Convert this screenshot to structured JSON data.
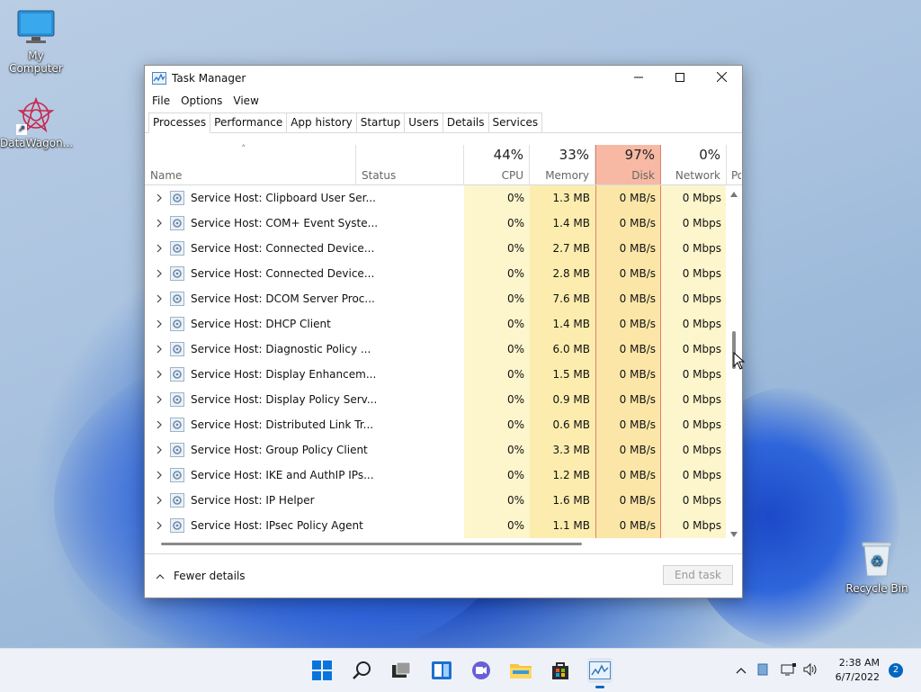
{
  "desktop": {
    "icons": [
      {
        "label": "My Computer",
        "icon": "monitor-icon"
      },
      {
        "label": "DataWagon...",
        "icon": "datawagon-shortcut-icon"
      },
      {
        "label": "Recycle Bin",
        "icon": "recycle-bin-icon"
      }
    ]
  },
  "window": {
    "title": "Task Manager",
    "menu": [
      "File",
      "Options",
      "View"
    ],
    "tabs": [
      "Processes",
      "Performance",
      "App history",
      "Startup",
      "Users",
      "Details",
      "Services"
    ],
    "active_tab": "Processes",
    "columns": {
      "name": "Name",
      "status": "Status",
      "cpu": {
        "pct": "44%",
        "label": "CPU"
      },
      "memory": {
        "pct": "33%",
        "label": "Memory"
      },
      "disk": {
        "pct": "97%",
        "label": "Disk"
      },
      "network": {
        "pct": "0%",
        "label": "Network"
      },
      "power_cut": "Po"
    },
    "rows": [
      {
        "name": "Service Host: Clipboard User Ser...",
        "cpu": "0%",
        "memory": "1.3 MB",
        "disk": "0 MB/s",
        "network": "0 Mbps"
      },
      {
        "name": "Service Host: COM+ Event Syste...",
        "cpu": "0%",
        "memory": "1.4 MB",
        "disk": "0 MB/s",
        "network": "0 Mbps"
      },
      {
        "name": "Service Host: Connected Device...",
        "cpu": "0%",
        "memory": "2.7 MB",
        "disk": "0 MB/s",
        "network": "0 Mbps"
      },
      {
        "name": "Service Host: Connected Device...",
        "cpu": "0%",
        "memory": "2.8 MB",
        "disk": "0 MB/s",
        "network": "0 Mbps"
      },
      {
        "name": "Service Host: DCOM Server Proc...",
        "cpu": "0%",
        "memory": "7.6 MB",
        "disk": "0 MB/s",
        "network": "0 Mbps"
      },
      {
        "name": "Service Host: DHCP Client",
        "cpu": "0%",
        "memory": "1.4 MB",
        "disk": "0 MB/s",
        "network": "0 Mbps"
      },
      {
        "name": "Service Host: Diagnostic Policy ...",
        "cpu": "0%",
        "memory": "6.0 MB",
        "disk": "0 MB/s",
        "network": "0 Mbps"
      },
      {
        "name": "Service Host: Display Enhancem...",
        "cpu": "0%",
        "memory": "1.5 MB",
        "disk": "0 MB/s",
        "network": "0 Mbps"
      },
      {
        "name": "Service Host: Display Policy Serv...",
        "cpu": "0%",
        "memory": "0.9 MB",
        "disk": "0 MB/s",
        "network": "0 Mbps"
      },
      {
        "name": "Service Host: Distributed Link Tr...",
        "cpu": "0%",
        "memory": "0.6 MB",
        "disk": "0 MB/s",
        "network": "0 Mbps"
      },
      {
        "name": "Service Host: Group Policy Client",
        "cpu": "0%",
        "memory": "3.3 MB",
        "disk": "0 MB/s",
        "network": "0 Mbps"
      },
      {
        "name": "Service Host: IKE and AuthIP IPs...",
        "cpu": "0%",
        "memory": "1.2 MB",
        "disk": "0 MB/s",
        "network": "0 Mbps"
      },
      {
        "name": "Service Host: IP Helper",
        "cpu": "0%",
        "memory": "1.6 MB",
        "disk": "0 MB/s",
        "network": "0 Mbps"
      },
      {
        "name": "Service Host: IPsec Policy Agent",
        "cpu": "0%",
        "memory": "1.1 MB",
        "disk": "0 MB/s",
        "network": "0 Mbps"
      }
    ],
    "footer": {
      "fewer_details": "Fewer details",
      "end_task": "End task"
    }
  },
  "taskbar": {
    "apps": [
      "start-icon",
      "search-icon",
      "task-view-icon",
      "widgets-icon",
      "chat-icon",
      "file-explorer-icon",
      "store-icon",
      "task-manager-icon"
    ],
    "clock": {
      "time": "2:38 AM",
      "date": "6/7/2022"
    },
    "notification_count": "2"
  },
  "colors": {
    "cpu_col": "#fdf5cc",
    "memory_col": "#fcedae",
    "disk_col": "#fbe6a8",
    "disk_header": "#f7b9a4",
    "network_col": "#fdf5cc",
    "accent": "#0067c0"
  }
}
